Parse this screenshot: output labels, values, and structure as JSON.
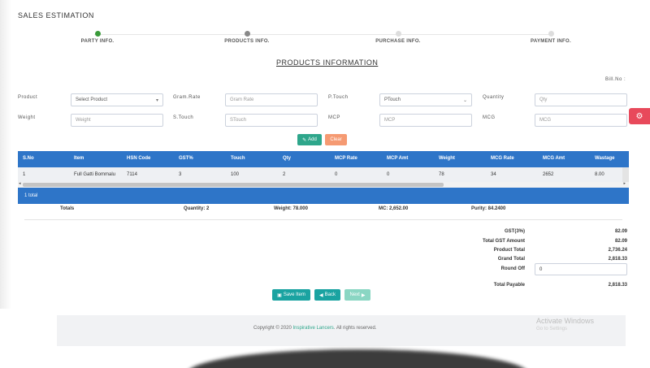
{
  "page_title": "SALES ESTIMATION",
  "steps": [
    {
      "label": "PARTY INFO.",
      "color": "#3a9a3a"
    },
    {
      "label": "PRODUCTS INFO.",
      "color": "#888888"
    },
    {
      "label": "PURCHASE INFO.",
      "color": "#dddddd"
    },
    {
      "label": "PAYMENT INFO.",
      "color": "#dddddd"
    }
  ],
  "section_title": "PRODUCTS INFORMATION",
  "bill_no_label": "Bill.No :",
  "form": {
    "product_label": "Product",
    "product_value": "Select Product",
    "gram_rate_label": "Gram.Rate",
    "gram_rate_placeholder": "Gram Rate",
    "ptouch_label": "P.Touch",
    "ptouch_value": "PTouch",
    "quantity_label": "Quantity",
    "quantity_placeholder": "Qty",
    "weight_label": "Weight",
    "weight_placeholder": "Weight",
    "stouch_label": "S.Touch",
    "stouch_placeholder": "STouch",
    "mcp_label": "MCP",
    "mcp_placeholder": "MCP",
    "mcg_label": "MCG",
    "mcg_placeholder": "MCG",
    "add_label": "Add",
    "clear_label": "Clear"
  },
  "table": {
    "headers": [
      "S.No",
      "Item",
      "HSN Code",
      "GST%",
      "Touch",
      "Qty",
      "MCP Rate",
      "MCP Amt",
      "Weight",
      "MCG Rate",
      "MCG Amt",
      "Wastage"
    ],
    "rows": [
      [
        "1",
        "Full Gatti Bommalu",
        "7114",
        "3",
        "100",
        "2",
        "0",
        "0",
        "78",
        "34",
        "2652",
        "8.00"
      ]
    ],
    "footer": "1 total"
  },
  "totals": {
    "label": "Totals",
    "quantity": "Quantity: 2",
    "weight": "Weight: 78.000",
    "mc": "MC: 2,652.00",
    "purity": "Purity: 84.2400"
  },
  "summary": {
    "gst_label": "GST(3%)",
    "gst_value": "82.09",
    "total_gst_label": "Total GST Amount",
    "total_gst_value": "82.09",
    "product_total_label": "Product Total",
    "product_total_value": "2,736.24",
    "grand_total_label": "Grand Total",
    "grand_total_value": "2,818.33",
    "round_off_label": "Round Off",
    "round_off_value": "0",
    "total_payable_label": "Total Payable",
    "total_payable_value": "2,818.33"
  },
  "actions": {
    "save_label": "Save Item",
    "back_label": "Back",
    "next_label": "Next"
  },
  "footer": {
    "copyright_prefix": "Copyright © 2020",
    "brand": "Inspirative Lancers",
    "copyright_suffix": ". All rights reserved.",
    "activate_title": "Activate Windows",
    "activate_sub": "Go to Settings"
  },
  "colors": {
    "accent_green": "#2ea68b",
    "table_blue": "#2e75c8",
    "clear_orange": "#f59a72",
    "settings_red": "#e8495b"
  }
}
